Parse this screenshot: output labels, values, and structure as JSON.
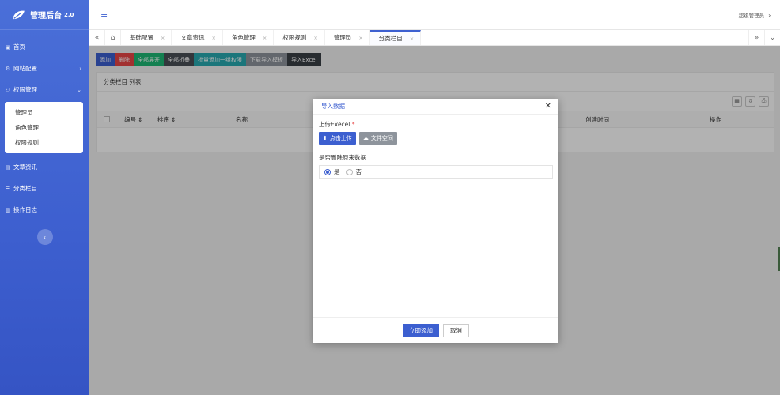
{
  "app": {
    "title": "管理后台",
    "version": "2.0"
  },
  "header": {
    "user": "超级管理员",
    "menu_icon": "hamburger-icon"
  },
  "sidebar": {
    "items": [
      {
        "label": "首页",
        "icon": "home-icon"
      },
      {
        "label": "网站配置",
        "icon": "gear-icon",
        "arrow": "›"
      },
      {
        "label": "权限管理",
        "icon": "users-icon",
        "arrow": "⌄"
      }
    ],
    "submenu": [
      {
        "label": "管理员"
      },
      {
        "label": "角色管理"
      },
      {
        "label": "权限规则"
      }
    ],
    "items2": [
      {
        "label": "文章资讯",
        "icon": "document-icon"
      },
      {
        "label": "分类栏目",
        "icon": "list-icon"
      },
      {
        "label": "操作日志",
        "icon": "log-icon"
      }
    ],
    "collapse": "‹"
  },
  "tabs": [
    {
      "label": "基础配置"
    },
    {
      "label": "文章资讯"
    },
    {
      "label": "角色管理"
    },
    {
      "label": "权限规则"
    },
    {
      "label": "管理员"
    },
    {
      "label": "分类栏目",
      "active": true
    }
  ],
  "toolbar": {
    "add": "添加",
    "delete": "删除",
    "expand_all": "全部展开",
    "collapse_all": "全部折叠",
    "batch_add": "批量添加一组权限",
    "download_template": "下载导入模板",
    "import_excel": "导入Excel"
  },
  "panel": {
    "title": "分类栏目 列表",
    "columns": {
      "id": "编号",
      "sort": "排序",
      "name": "名称",
      "created": "创建时间",
      "action": "操作"
    }
  },
  "modal": {
    "title": "导入数据",
    "upload_label": "上传Execel",
    "required_mark": "*",
    "upload_btn": "点击上传",
    "file_space_btn": "文件空间",
    "delete_label": "是否删除原来数据",
    "option_yes": "是",
    "option_no": "否",
    "submit": "立即添加",
    "cancel": "取消"
  }
}
